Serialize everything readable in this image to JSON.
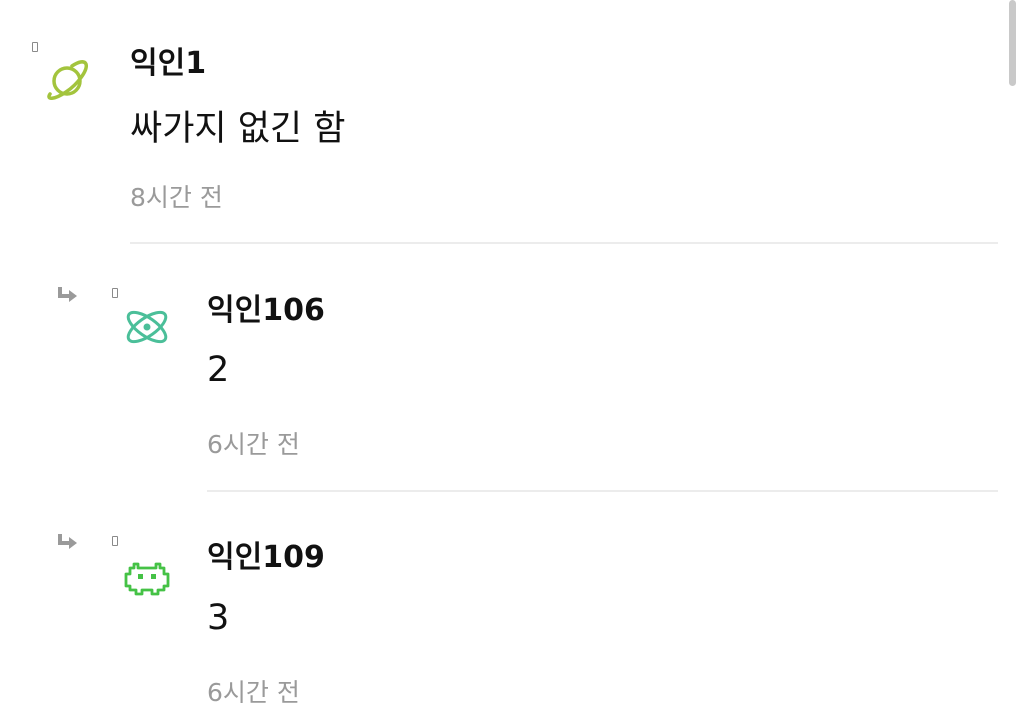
{
  "comments": [
    {
      "author": "익인1",
      "text": "싸가지 없긴 함",
      "time": "8시간 전",
      "avatar_icon": "planet-icon",
      "avatar_color": "#a3c43d",
      "is_reply": false
    },
    {
      "author": "익인106",
      "text": "2",
      "time": "6시간 전",
      "avatar_icon": "atom-icon",
      "avatar_color": "#4bbf99",
      "is_reply": true
    },
    {
      "author": "익인109",
      "text": "3",
      "time": "6시간 전",
      "avatar_icon": "space-invader-icon",
      "avatar_color": "#45c246",
      "is_reply": true
    }
  ],
  "colors": {
    "text_primary": "#111111",
    "text_secondary": "#9a9a9a",
    "divider": "#ececec",
    "reply_arrow": "#9a9a9a"
  }
}
